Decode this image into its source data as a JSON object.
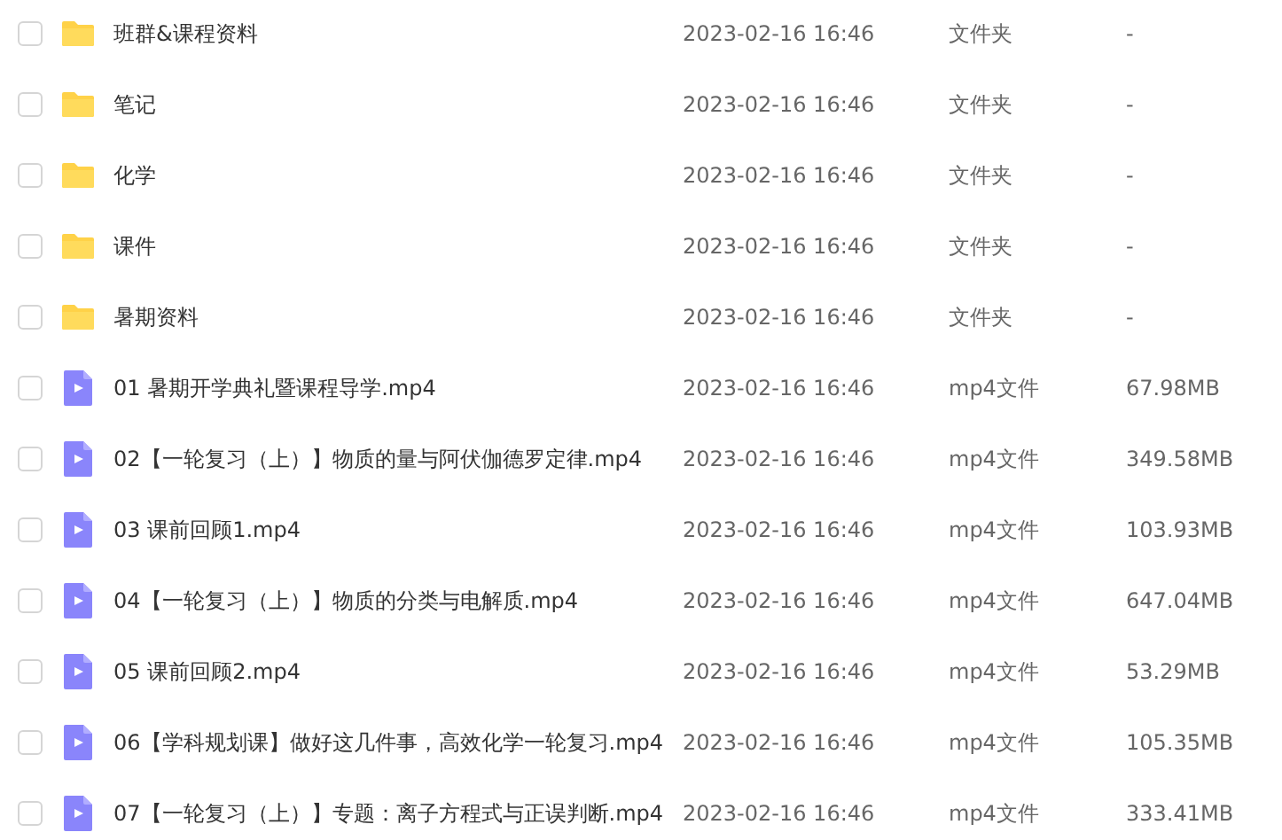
{
  "files": [
    {
      "kind": "folder",
      "checked": false,
      "name": "班群&课程资料",
      "modified": "2023-02-16 16:46",
      "type": "文件夹",
      "size": "-"
    },
    {
      "kind": "folder",
      "checked": false,
      "name": "笔记",
      "modified": "2023-02-16 16:46",
      "type": "文件夹",
      "size": "-"
    },
    {
      "kind": "folder",
      "checked": false,
      "name": "化学",
      "modified": "2023-02-16 16:46",
      "type": "文件夹",
      "size": "-"
    },
    {
      "kind": "folder",
      "checked": false,
      "name": "课件",
      "modified": "2023-02-16 16:46",
      "type": "文件夹",
      "size": "-"
    },
    {
      "kind": "folder",
      "checked": false,
      "name": "暑期资料",
      "modified": "2023-02-16 16:46",
      "type": "文件夹",
      "size": "-"
    },
    {
      "kind": "video",
      "checked": false,
      "name": "01 暑期开学典礼暨课程导学.mp4",
      "modified": "2023-02-16 16:46",
      "type": "mp4文件",
      "size": "67.98MB"
    },
    {
      "kind": "video",
      "checked": false,
      "name": "02【一轮复习（上）】物质的量与阿伏伽德罗定律.mp4",
      "modified": "2023-02-16 16:46",
      "type": "mp4文件",
      "size": "349.58MB"
    },
    {
      "kind": "video",
      "checked": false,
      "name": "03 课前回顾1.mp4",
      "modified": "2023-02-16 16:46",
      "type": "mp4文件",
      "size": "103.93MB"
    },
    {
      "kind": "video",
      "checked": false,
      "name": "04【一轮复习（上）】物质的分类与电解质.mp4",
      "modified": "2023-02-16 16:46",
      "type": "mp4文件",
      "size": "647.04MB"
    },
    {
      "kind": "video",
      "checked": false,
      "name": "05 课前回顾2.mp4",
      "modified": "2023-02-16 16:46",
      "type": "mp4文件",
      "size": "53.29MB"
    },
    {
      "kind": "video",
      "checked": false,
      "name": "06【学科规划课】做好这几件事，高效化学一轮复习.mp4",
      "modified": "2023-02-16 16:46",
      "type": "mp4文件",
      "size": "105.35MB"
    },
    {
      "kind": "video",
      "checked": false,
      "name": "07【一轮复习（上）】专题：离子方程式与正误判断.mp4",
      "modified": "2023-02-16 16:46",
      "type": "mp4文件",
      "size": "333.41MB"
    }
  ]
}
